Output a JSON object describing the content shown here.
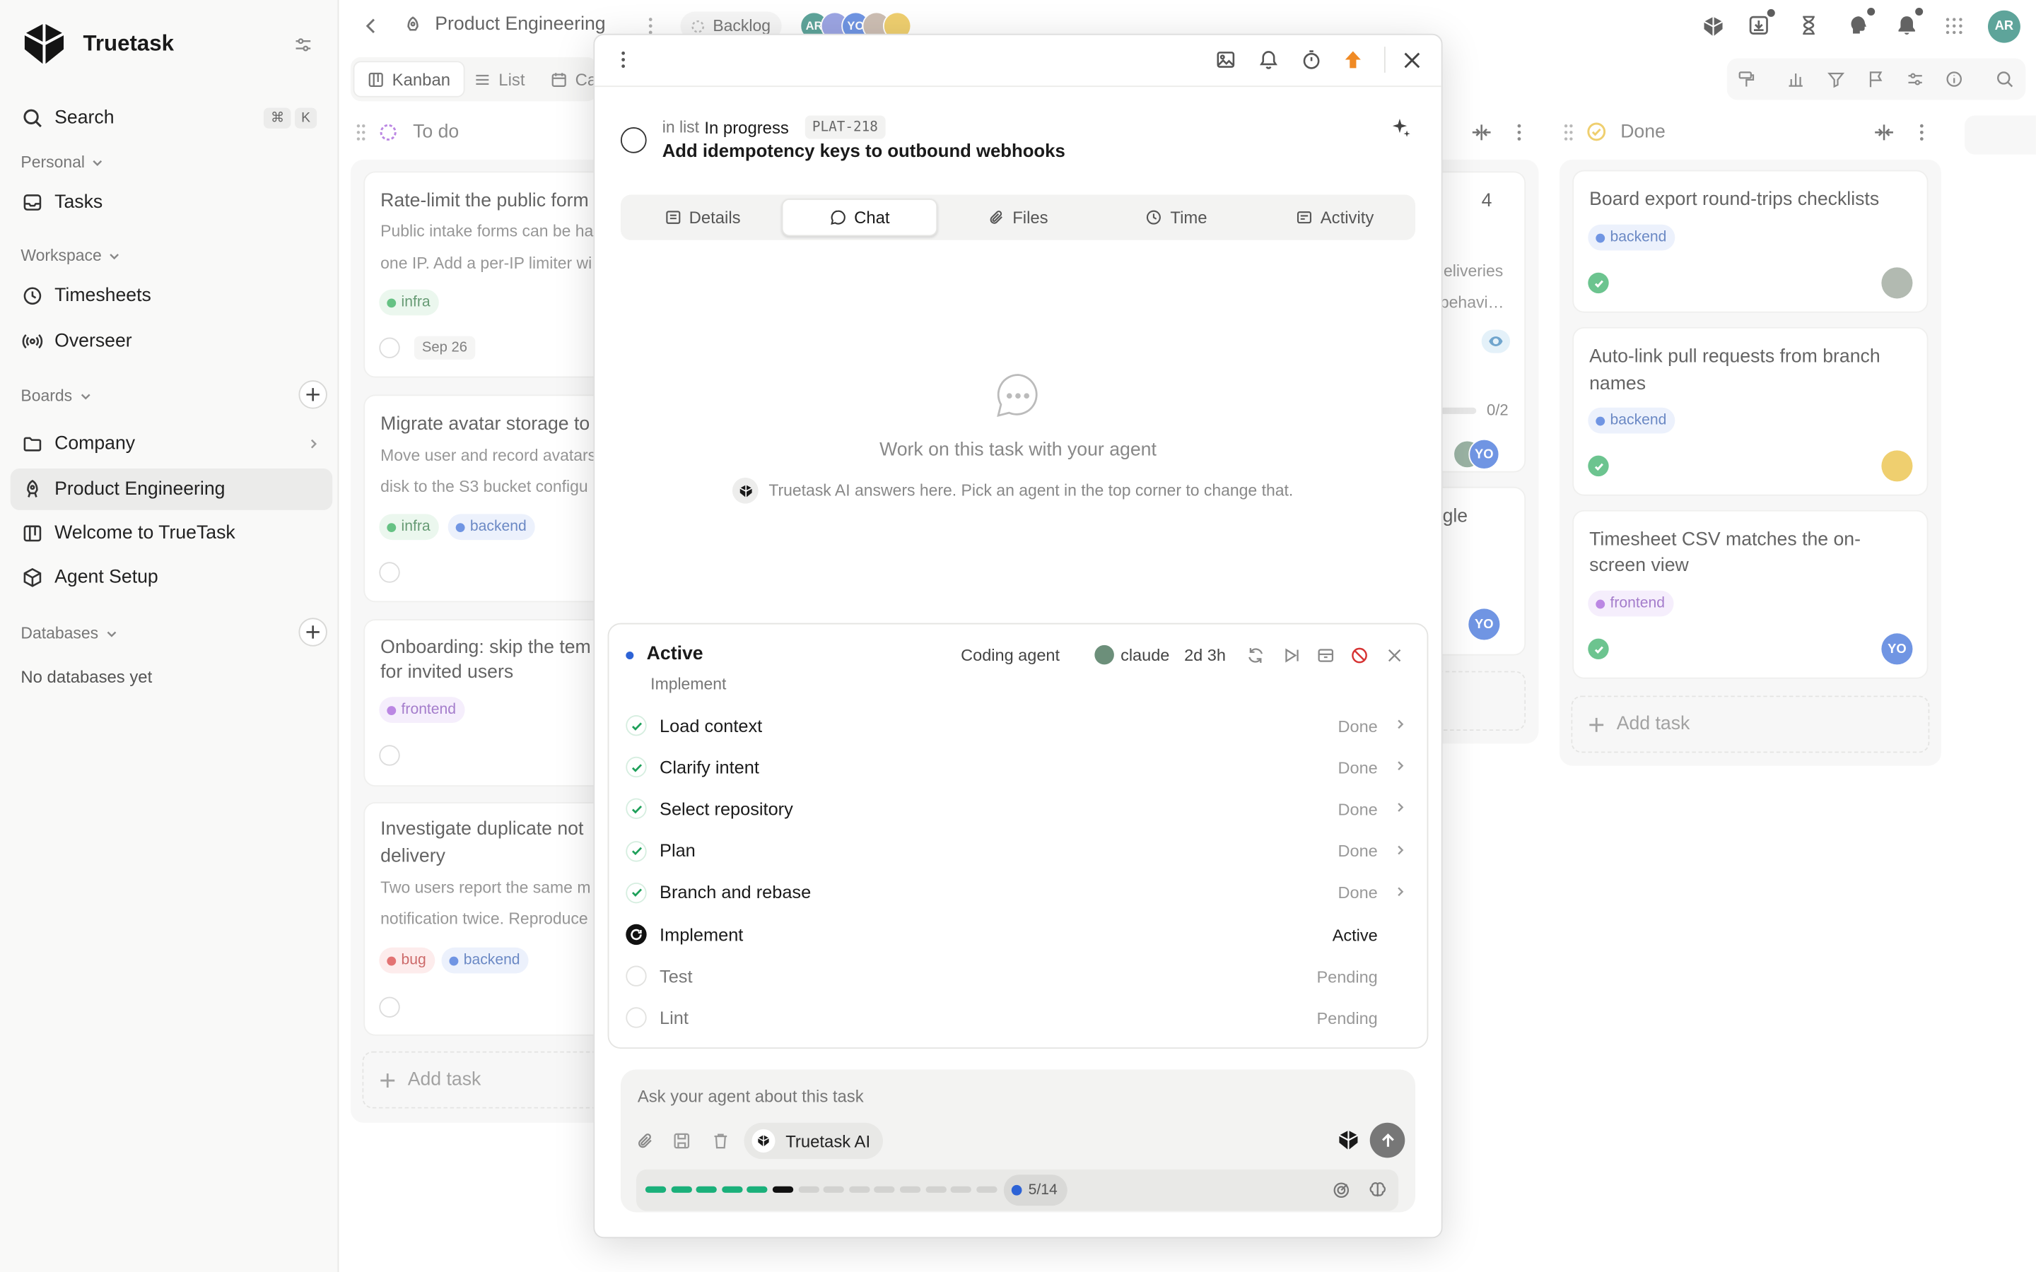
{
  "app": {
    "name": "Truetask",
    "user_initials": "AR"
  },
  "sidebar": {
    "search_label": "Search",
    "shortcut_cmd": "⌘",
    "shortcut_key": "K",
    "personal_label": "Personal",
    "tasks_label": "Tasks",
    "workspace_label": "Workspace",
    "timesheets_label": "Timesheets",
    "overseer_label": "Overseer",
    "boards_label": "Boards",
    "boards": [
      {
        "label": "Company"
      },
      {
        "label": "Product Engineering"
      },
      {
        "label": "Welcome to TrueTask"
      },
      {
        "label": "Agent Setup"
      }
    ],
    "databases_label": "Databases",
    "databases_empty": "No databases yet"
  },
  "topbar": {
    "board_title": "Product Engineering",
    "status_chip": "Backlog",
    "member_initials": [
      "AR",
      "YO"
    ]
  },
  "views": {
    "kanban": "Kanban",
    "list": "List",
    "calendar": "Ca"
  },
  "columns": {
    "todo": {
      "title": "To do",
      "add_label": "Add task",
      "cards": [
        {
          "title": "Rate-limit the public form",
          "desc": [
            "Public intake forms can be ha",
            "one IP. Add a per-IP limiter wi"
          ],
          "tags": [
            "infra"
          ],
          "date": "Sep 26"
        },
        {
          "title": "Migrate avatar storage to",
          "desc": [
            "Move user and record avatars",
            "disk to the S3 bucket configu"
          ],
          "tags": [
            "infra",
            "backend"
          ]
        },
        {
          "title": [
            "Onboarding: skip the tem",
            "for invited users"
          ],
          "tags": [
            "frontend"
          ]
        },
        {
          "title": [
            "Investigate duplicate not",
            "delivery"
          ],
          "desc": [
            "Two users report the same m",
            "notification twice. Reproduce"
          ],
          "tags": [
            "bug",
            "backend"
          ]
        }
      ]
    },
    "progress": {
      "card1_title": "4",
      "card1_desc": [
        "leliveries",
        "behavi…"
      ],
      "progress": "0/2",
      "card2_title": "gle",
      "avatar": "YO"
    },
    "done": {
      "title": "Done",
      "add_label": "Add task",
      "cards": [
        {
          "title": [
            "Board export round-trips checklists"
          ],
          "tag": "backend"
        },
        {
          "title": [
            "Auto-link pull requests from branch",
            "names"
          ],
          "tag": "backend"
        },
        {
          "title": [
            "Timesheet CSV matches the on-",
            "screen view"
          ],
          "tag": "frontend",
          "avatar": "YO"
        }
      ]
    }
  },
  "tags": {
    "infra": "infra",
    "backend": "backend",
    "frontend": "frontend",
    "bug": "bug"
  },
  "modal": {
    "list_prefix": "in list",
    "list_name": "In progress",
    "task_id": "PLAT-218",
    "task_title": "Add idempotency keys to outbound webhooks",
    "tabs": [
      "Details",
      "Chat",
      "Files",
      "Time",
      "Activity"
    ],
    "empty_title": "Work on this task with your agent",
    "empty_sub": "Truetask AI answers here. Pick an agent in the top corner to change that.",
    "run": {
      "status": "Active",
      "phase": "Implement",
      "agent_type": "Coding agent",
      "agent_name": "claude",
      "duration": "2d 3h",
      "steps": [
        {
          "label": "Load context",
          "status": "Done",
          "state": "done"
        },
        {
          "label": "Clarify intent",
          "status": "Done",
          "state": "done"
        },
        {
          "label": "Select repository",
          "status": "Done",
          "state": "done"
        },
        {
          "label": "Plan",
          "status": "Done",
          "state": "done"
        },
        {
          "label": "Branch and rebase",
          "status": "Done",
          "state": "done"
        },
        {
          "label": "Implement",
          "status": "Active",
          "state": "active"
        },
        {
          "label": "Test",
          "status": "Pending",
          "state": "pending"
        },
        {
          "label": "Lint",
          "status": "Pending",
          "state": "pending"
        }
      ]
    },
    "composer": {
      "placeholder": "Ask your agent about this task",
      "agent_chip": "Truetask AI",
      "progress_label": "5/14",
      "progress_done": 5,
      "progress_active": 1,
      "progress_total": 14
    }
  },
  "colors": {
    "accent": "#2d63d6",
    "done": "#27a85a",
    "progress": "#1ab07a",
    "warning": "#f08a24",
    "danger": "#d63232"
  }
}
